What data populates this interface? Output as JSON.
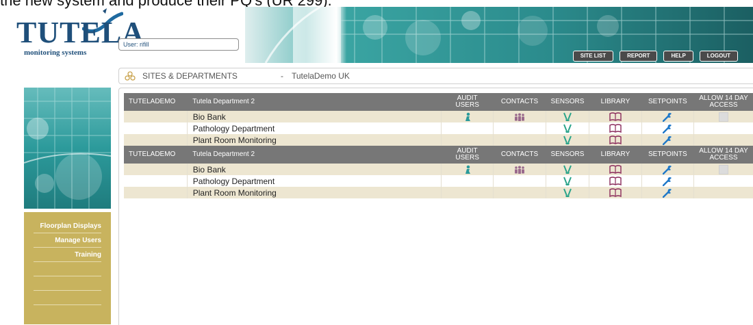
{
  "caption": "the new system and produce their PQ's (UR 299).",
  "logo": {
    "word": "TUTELA",
    "sub": "monitoring systems"
  },
  "user_field": "User: rifill",
  "topnav": {
    "site_list": "SITE LIST",
    "report": "REPORT",
    "help": "HELP",
    "logout": "LOGOUT"
  },
  "breadcrumb": {
    "title": "SITES & DEPARTMENTS",
    "sep": "-",
    "site": "TutelaDemo UK"
  },
  "sidebar": {
    "links": [
      "Floorplan Displays",
      "Manage Users",
      "Training"
    ]
  },
  "table": {
    "headers": {
      "org": "TUTELADEMO",
      "dept": "Tutela Department 2",
      "audit_users": [
        "AUDIT",
        "USERS"
      ],
      "contacts": "CONTACTS",
      "sensors": "SENSORS",
      "library": "LIBRARY",
      "setpoints": "SETPOINTS",
      "allow": [
        "ALLOW 14 DAY",
        "ACCESS"
      ]
    },
    "groups": [
      {
        "rows": [
          {
            "name": "Bio Bank",
            "audit": true,
            "contacts": true,
            "sensors": true,
            "library": true,
            "setpoints": true,
            "allow": true
          },
          {
            "name": "Pathology Department",
            "audit": false,
            "contacts": false,
            "sensors": true,
            "library": true,
            "setpoints": true,
            "allow": false
          },
          {
            "name": "Plant Room Monitoring",
            "audit": false,
            "contacts": false,
            "sensors": true,
            "library": true,
            "setpoints": true,
            "allow": false
          }
        ]
      },
      {
        "rows": [
          {
            "name": "Bio Bank",
            "audit": true,
            "contacts": true,
            "sensors": true,
            "library": true,
            "setpoints": true,
            "allow": true
          },
          {
            "name": "Pathology Department",
            "audit": false,
            "contacts": false,
            "sensors": true,
            "library": true,
            "setpoints": true,
            "allow": false
          },
          {
            "name": "Plant Room Monitoring",
            "audit": false,
            "contacts": false,
            "sensors": true,
            "library": true,
            "setpoints": true,
            "allow": false
          }
        ]
      }
    ]
  },
  "icons": {
    "audit": "audit-user-icon",
    "contacts": "contacts-people-icon",
    "sensors": "sensor-probe-icon",
    "library": "library-book-icon",
    "setpoints": "setpoint-wrench-icon"
  },
  "colors": {
    "header_bg": "#777777",
    "row_alt": "#ede6d1",
    "sidebar_gold": "#c8b35e",
    "teal": "#2a9a9a",
    "nav_btn": "#4a4a4a"
  }
}
